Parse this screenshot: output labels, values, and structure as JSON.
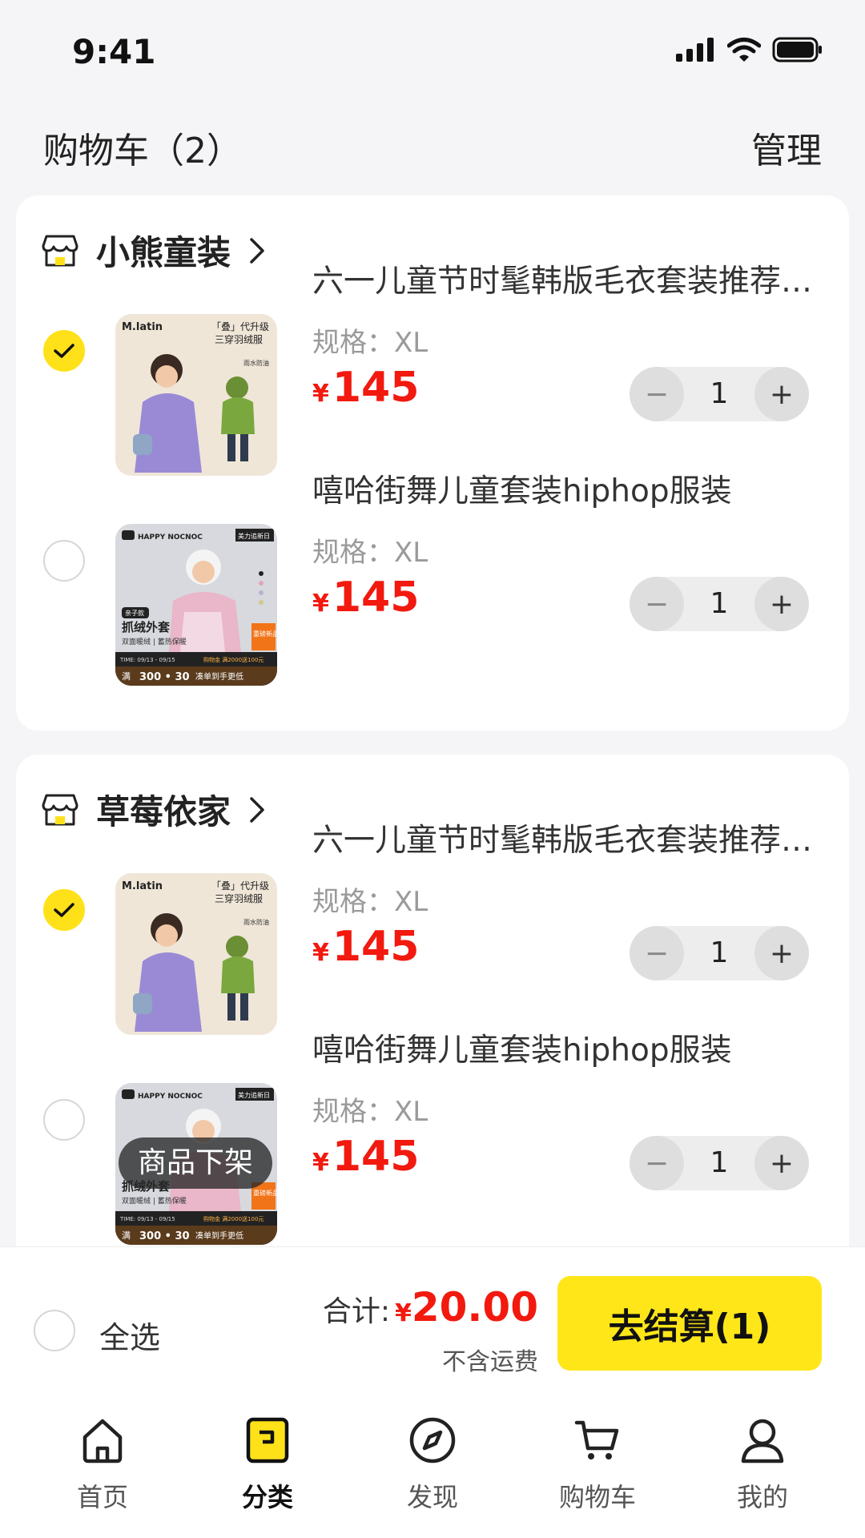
{
  "status_bar": {
    "time": "9:41"
  },
  "header": {
    "title": "购物车（2）",
    "manage_label": "管理"
  },
  "stores": [
    {
      "name": "小熊童装",
      "items": [
        {
          "title": "六一儿童节时髦韩版毛衣套装推荐…",
          "spec": "规格：XL",
          "currency": "¥",
          "price": "145",
          "quantity": "1",
          "checked": true
        },
        {
          "title": "嘻哈街舞儿童套装hiphop服装",
          "spec": "规格：XL",
          "currency": "¥",
          "price": "145",
          "quantity": "1",
          "checked": false
        }
      ]
    },
    {
      "name": "草莓依家",
      "items": [
        {
          "title": "六一儿童节时髦韩版毛衣套装推荐…",
          "spec": "规格：XL",
          "currency": "¥",
          "price": "145",
          "quantity": "1",
          "checked": true
        },
        {
          "title": "嘻哈街舞儿童套装hiphop服装",
          "spec": "规格：XL",
          "currency": "¥",
          "price": "145",
          "quantity": "1",
          "checked": false,
          "badge": "商品下架"
        }
      ]
    }
  ],
  "product_images": {
    "jacket": {
      "brand": "M.latin",
      "headline": "「叠」代升级",
      "subline": "三穿羽绒服",
      "tag": "雨水防油"
    },
    "fleece": {
      "brand": "HAPPY NOCNOC",
      "corner": "美力追新日",
      "pill": "亲子款",
      "headline": "抓绒外套",
      "subline": "双面暖绒 | 蓄热保暖",
      "side_badge": "重磅新品",
      "time": "TIME: 09/13 - 09/15",
      "coupon": "购物金 满2000送100元",
      "promo_left": "满",
      "promo_value": "300 • 30",
      "promo_right": "凑单到手更低"
    }
  },
  "checkout": {
    "select_all_label": "全选",
    "total_label": "合计:",
    "total_currency": "¥",
    "total_value": "20.00",
    "shipping_note": "不含运费",
    "checkout_label": "去结算(1)"
  },
  "tabs": [
    {
      "label": "首页",
      "icon": "home-icon"
    },
    {
      "label": "分类",
      "icon": "category-icon",
      "active": true
    },
    {
      "label": "发现",
      "icon": "compass-icon"
    },
    {
      "label": "购物车",
      "icon": "cart-icon"
    },
    {
      "label": "我的",
      "icon": "profile-icon"
    }
  ],
  "colors": {
    "accent": "#FFE619",
    "price": "#F2190F",
    "background": "#F5F5F7"
  }
}
